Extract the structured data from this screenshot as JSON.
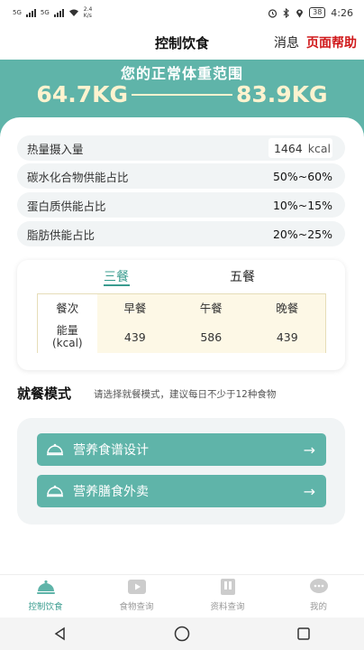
{
  "status_bar": {
    "signal1": "5G",
    "signal2": "5G",
    "speed_value": "2.4",
    "speed_unit": "K/s",
    "battery": "38",
    "time": "4:26"
  },
  "header": {
    "title": "控制饮食",
    "msg_label": "消息",
    "help_label": "页面帮助"
  },
  "hero": {
    "title": "您的正常体重范围",
    "min": "64.7KG",
    "max": "83.9KG"
  },
  "info_rows": [
    {
      "label": "热量摄入量",
      "value": "1464",
      "unit": "kcal"
    },
    {
      "label": "碳水化合物供能占比",
      "value": "50%~60%"
    },
    {
      "label": "蛋白质供能占比",
      "value": "10%~15%"
    },
    {
      "label": "脂肪供能占比",
      "value": "20%~25%"
    }
  ],
  "meal_tabs": {
    "three": "三餐",
    "five": "五餐",
    "active": "三餐"
  },
  "meal_table": {
    "headers": [
      "餐次",
      "早餐",
      "午餐",
      "晚餐"
    ],
    "row_label_line1": "能量",
    "row_label_line2": "(kcal)",
    "values": [
      "439",
      "586",
      "439"
    ]
  },
  "mode": {
    "title": "就餐模式",
    "hint": "请选择就餐模式，建议每日不少于12种食物",
    "buttons": [
      "营养食谱设计",
      "营养膳食外卖"
    ]
  },
  "tabbar": [
    {
      "label": "控制饮食",
      "icon": "dish-cover-icon",
      "active": true
    },
    {
      "label": "食物查询",
      "icon": "video-play-icon",
      "active": false
    },
    {
      "label": "资料查询",
      "icon": "book-icon",
      "active": false
    },
    {
      "label": "我的",
      "icon": "chat-bubble-icon",
      "active": false
    }
  ],
  "colors": {
    "accent": "#5fb4a9",
    "accent_dark": "#3a9c8f",
    "help_red": "#d0191b",
    "range_text": "#fff3cf"
  }
}
